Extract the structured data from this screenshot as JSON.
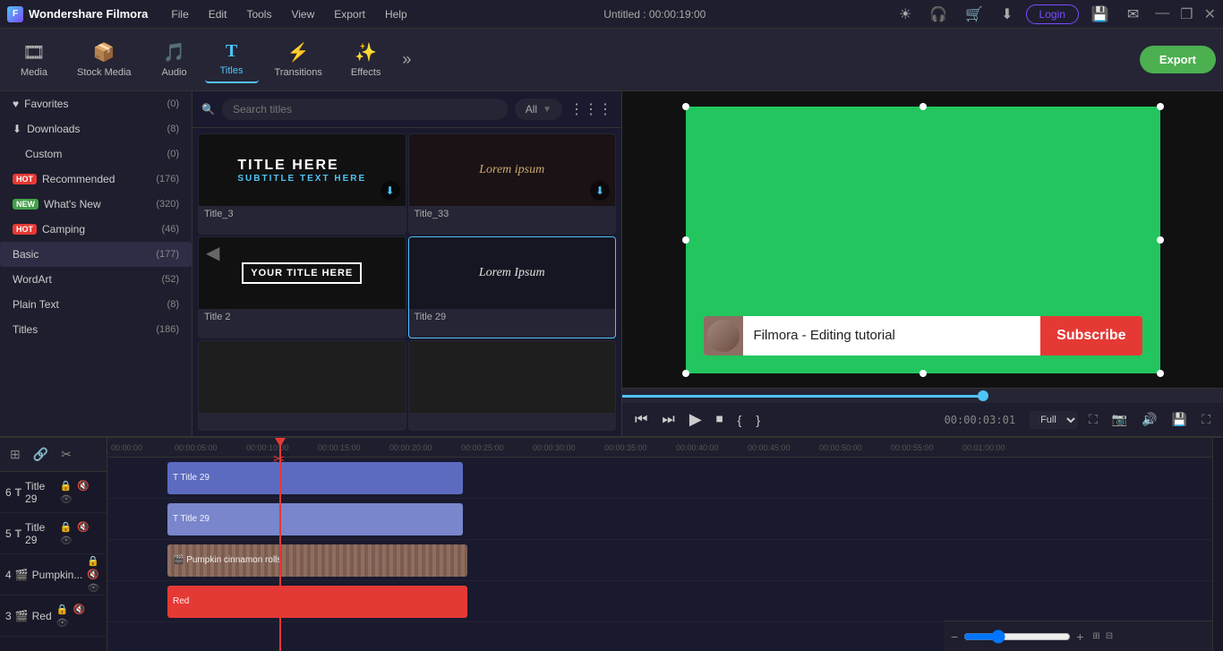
{
  "app": {
    "title": "Wondershare Filmora",
    "project_name": "Untitled",
    "duration": "00:00:19:00"
  },
  "titlebar": {
    "logo_text": "Wondershare Filmora",
    "menus": [
      "File",
      "Edit",
      "Tools",
      "View",
      "Export",
      "Help"
    ],
    "login_label": "Login",
    "window_controls": [
      "—",
      "❐",
      "✕"
    ],
    "title_display": "Untitled : 00:00:19:00"
  },
  "toolbar": {
    "items": [
      {
        "id": "media",
        "label": "Media",
        "icon": "🎞"
      },
      {
        "id": "stock",
        "label": "Stock Media",
        "icon": "📦"
      },
      {
        "id": "audio",
        "label": "Audio",
        "icon": "🎵"
      },
      {
        "id": "titles",
        "label": "Titles",
        "icon": "T"
      },
      {
        "id": "transitions",
        "label": "Transitions",
        "icon": "⚡"
      },
      {
        "id": "effects",
        "label": "Effects",
        "icon": "✨"
      }
    ],
    "more_btn": "»",
    "export_label": "Export"
  },
  "sidebar": {
    "items": [
      {
        "id": "favorites",
        "label": "Favorites",
        "count": "(0)",
        "badge": ""
      },
      {
        "id": "downloads",
        "label": "Downloads",
        "count": "(8)",
        "badge": ""
      },
      {
        "id": "custom",
        "label": "Custom",
        "count": "(0)",
        "badge": "",
        "indent": true
      },
      {
        "id": "recommended",
        "label": "Recommended",
        "count": "(176)",
        "badge": "HOT"
      },
      {
        "id": "whats-new",
        "label": "What's New",
        "count": "(320)",
        "badge": "NEW"
      },
      {
        "id": "camping",
        "label": "Camping",
        "count": "(46)",
        "badge": "HOT"
      },
      {
        "id": "basic",
        "label": "Basic",
        "count": "(177)",
        "badge": ""
      },
      {
        "id": "wordart",
        "label": "WordArt",
        "count": "(52)",
        "badge": ""
      },
      {
        "id": "plain-text",
        "label": "Plain Text",
        "count": "(8)",
        "badge": ""
      },
      {
        "id": "titles",
        "label": "Titles",
        "count": "(186)",
        "badge": ""
      }
    ]
  },
  "titles_panel": {
    "search_placeholder": "Search titles",
    "filter_label": "All",
    "cards": [
      {
        "id": "title_3",
        "label": "Title_3",
        "style": "title3",
        "has_download": true
      },
      {
        "id": "title_33",
        "label": "Title_33",
        "style": "title33",
        "has_download": true
      },
      {
        "id": "title_2",
        "label": "Title 2",
        "style": "title2",
        "has_download": false
      },
      {
        "id": "title_29",
        "label": "Title 29",
        "style": "title29",
        "has_download": false,
        "selected": true
      },
      {
        "id": "empty1",
        "label": "",
        "style": "empty",
        "has_download": false
      },
      {
        "id": "empty2",
        "label": "",
        "style": "empty",
        "has_download": false
      }
    ]
  },
  "preview": {
    "overlay": {
      "text": "Filmora - Editing tutorial",
      "subscribe_label": "Subscribe"
    },
    "time_current": "00:00:03:01",
    "quality": "Full"
  },
  "playback": {
    "controls": [
      "⏮",
      "⏭",
      "▶",
      "⏹"
    ],
    "time_code_left": "{",
    "time_code_right": "}",
    "time_display": "00:00:03:01"
  },
  "timeline": {
    "ruler_marks": [
      "00:00:00",
      "00:00:05:00",
      "00:00:10:00",
      "00:00:15:00",
      "00:00:20:00",
      "00:00:25:00",
      "00:00:30:00",
      "00:00:35:00",
      "00:00:40:00",
      "00:00:45:00",
      "00:00:50:00",
      "00:00:55:00",
      "00:01:00:00"
    ],
    "tracks": [
      {
        "num": "6",
        "type": "title",
        "label": "Title 29",
        "clip_color": "purple",
        "icon": "T"
      },
      {
        "num": "5",
        "type": "title",
        "label": "Title 29",
        "clip_color": "purple2",
        "icon": "T"
      },
      {
        "num": "4",
        "type": "video",
        "label": "Pumpkin cinnamon rolls",
        "clip_color": "brown"
      },
      {
        "num": "3",
        "type": "video",
        "label": "Red",
        "clip_color": "red"
      }
    ],
    "zoom_level": "zoom"
  },
  "colors": {
    "accent": "#4fc3f7",
    "green": "#22c55e",
    "purple": "#5c6bc0",
    "red": "#e53935",
    "bg_dark": "#1a1a2e",
    "bg_mid": "#1e1e2e",
    "bg_light": "#252535"
  }
}
